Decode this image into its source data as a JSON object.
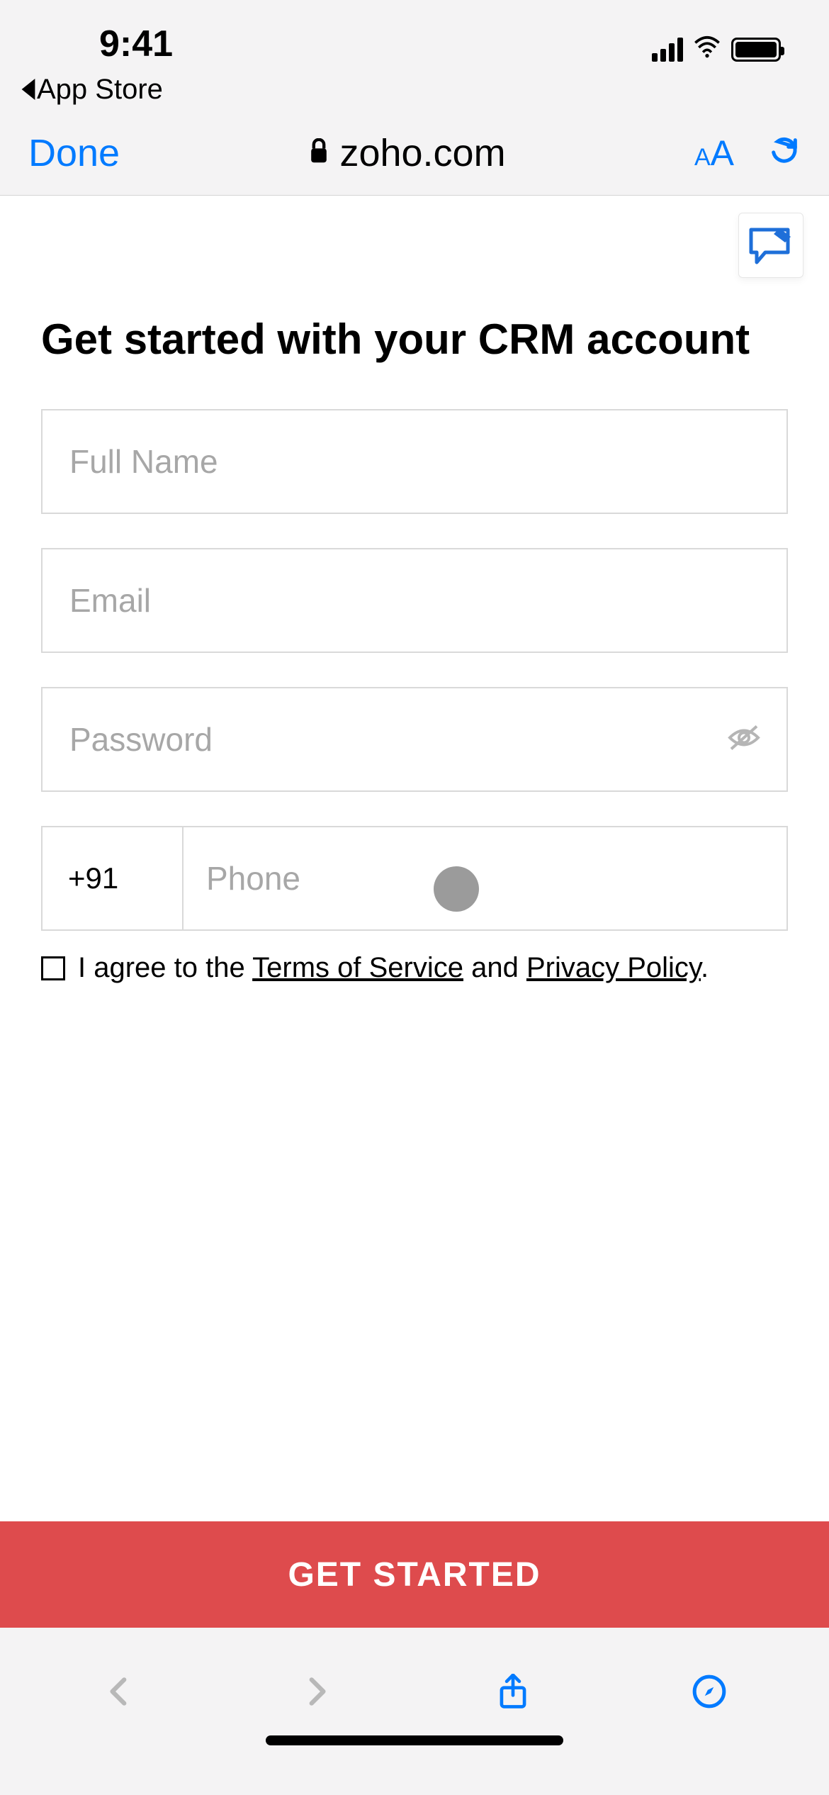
{
  "status": {
    "time": "9:41",
    "back_label": "App Store"
  },
  "browser": {
    "done": "Done",
    "domain": "zoho.com"
  },
  "form": {
    "heading": "Get started with your CRM account",
    "full_name_ph": "Full Name",
    "email_ph": "Email",
    "password_ph": "Password",
    "dial_code": "+91",
    "phone_ph": "Phone"
  },
  "consent": {
    "prefix": "I agree to the ",
    "tos": "Terms of Service",
    "mid": " and ",
    "privacy": "Privacy Policy",
    "suffix": "."
  },
  "cta": "GET STARTED"
}
